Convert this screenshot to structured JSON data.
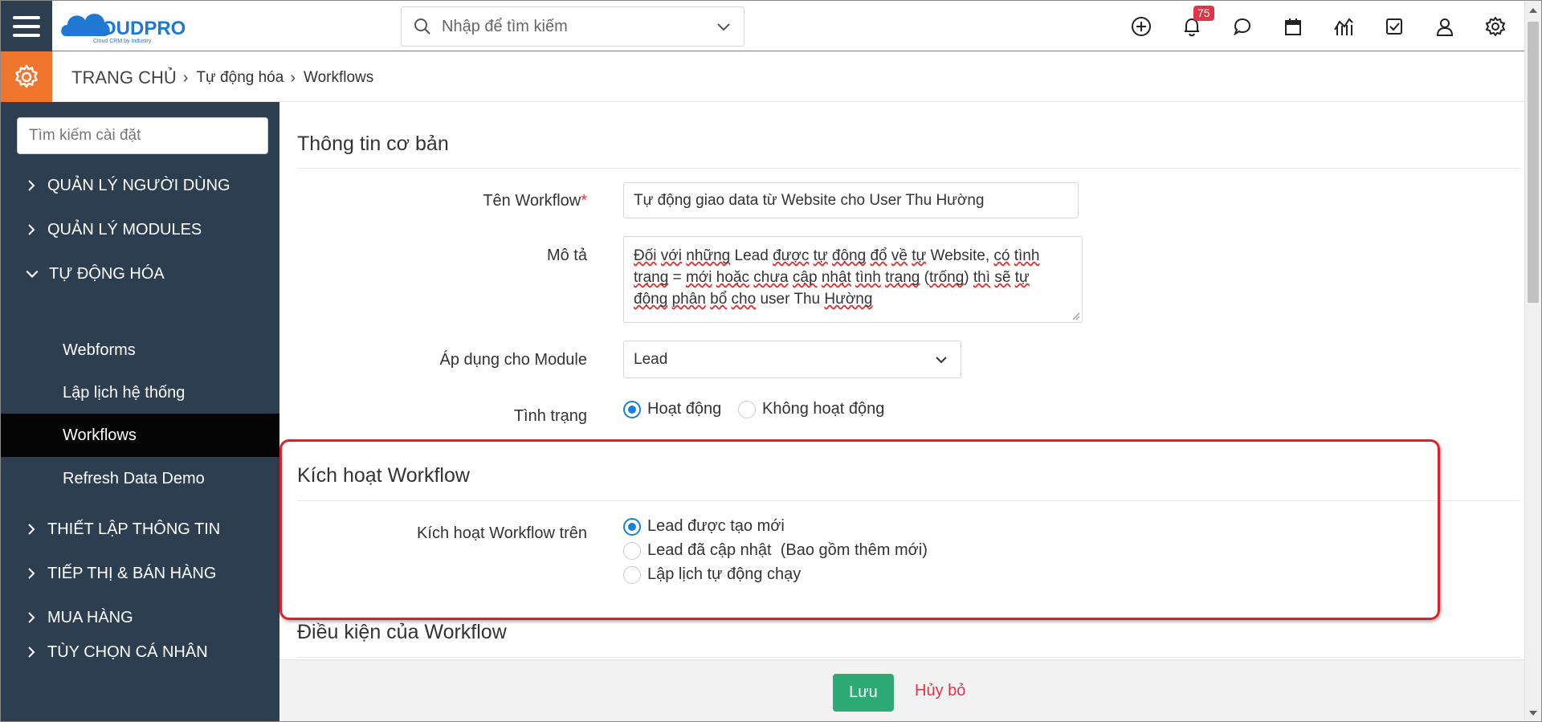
{
  "header": {
    "logo_text": "CLOUDPRO",
    "logo_tagline": "Cloud CRM by Industry",
    "search_placeholder": "Nhập để tìm kiếm",
    "notification_count": "75",
    "icons": [
      "plus-circle-icon",
      "bell-icon",
      "chat-icon",
      "calendar-icon",
      "chart-icon",
      "checkbox-icon",
      "user-icon",
      "gear-icon"
    ]
  },
  "breadcrumb": {
    "home": "TRANG CHỦ",
    "level1": "Tự động hóa",
    "level2": "Workflows"
  },
  "sidebar": {
    "search_placeholder": "Tìm kiếm cài đặt",
    "items": [
      {
        "label": "QUẢN LÝ NGƯỜI DÙNG",
        "expanded": false
      },
      {
        "label": "QUẢN LÝ MODULES",
        "expanded": false
      },
      {
        "label": "TỰ ĐỘNG HÓA",
        "expanded": true
      },
      {
        "label": "THIẾT LẬP THÔNG TIN",
        "expanded": false
      },
      {
        "label": "TIẾP THỊ & BÁN HÀNG",
        "expanded": false
      },
      {
        "label": "MUA HÀNG",
        "expanded": false
      },
      {
        "label": "TÙY CHỌN CÁ NHÂN",
        "expanded": false
      }
    ],
    "subitems": [
      {
        "label": "Webforms",
        "active": false
      },
      {
        "label": "Lập lịch hệ thống",
        "active": false
      },
      {
        "label": "Workflows",
        "active": true
      },
      {
        "label": "Refresh Data Demo",
        "active": false
      }
    ]
  },
  "basic_info": {
    "title": "Thông tin cơ bản",
    "name_label": "Tên Workflow",
    "required_mark": "*",
    "name_value": "Tự động giao data từ Website cho User Thu Hường",
    "desc_label": "Mô tả",
    "desc_line1_parts": [
      "Đối",
      " ",
      "với",
      " ",
      "những",
      " Lead ",
      "được",
      " ",
      "tự",
      " ",
      "động",
      " ",
      "đổ",
      " ",
      "về",
      " ",
      "tự",
      " Website, ",
      "có",
      " ",
      "tình"
    ],
    "desc_line2_parts": [
      "trạng",
      " = ",
      "mới",
      " ",
      "hoặc",
      " ",
      "chưa",
      " ",
      "cập",
      " ",
      "nhật",
      " ",
      "tình",
      " ",
      "trạng",
      " (",
      "trống",
      ") ",
      "thì",
      " ",
      "sẽ",
      " ",
      "tự"
    ],
    "desc_line3_parts": [
      "động",
      " ",
      "phân",
      " ",
      "bổ",
      " ",
      "cho",
      " user Thu ",
      "Hường"
    ],
    "module_label": "Áp dụng cho Module",
    "module_value": "Lead",
    "status_label": "Tình trạng",
    "status_options": [
      {
        "label": "Hoạt động",
        "selected": true
      },
      {
        "label": "Không hoạt động",
        "selected": false
      }
    ]
  },
  "trigger": {
    "title": "Kích hoạt Workflow",
    "label": "Kích hoạt Workflow trên",
    "options": [
      {
        "label": "Lead được tạo mới",
        "selected": true
      },
      {
        "label": "Lead đã cập nhật  (Bao gồm thêm mới)",
        "selected": false
      },
      {
        "label": "Lập lịch tự động chạy",
        "selected": false
      }
    ]
  },
  "conditions": {
    "title": "Điều kiện của Workflow"
  },
  "footer": {
    "save_label": "Lưu",
    "cancel_label": "Hủy bỏ"
  },
  "colors": {
    "sidebar_bg": "#2c3e50",
    "accent_orange": "#f0762e",
    "save_green": "#2eaa74",
    "cancel_red": "#e0344a",
    "highlight_red": "#e01f26",
    "radio_blue": "#1a7fd6"
  }
}
